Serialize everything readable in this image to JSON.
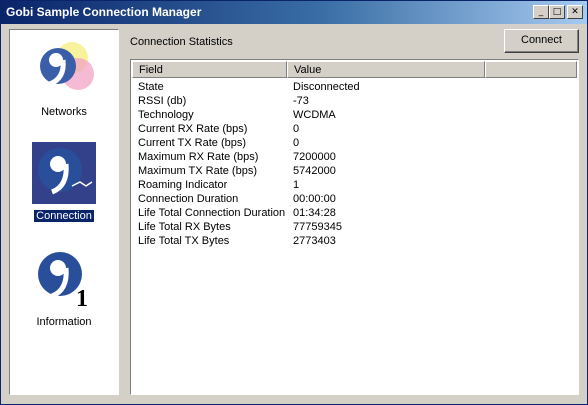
{
  "window": {
    "title": "Gobi Sample Connection Manager"
  },
  "titlebar_buttons": {
    "minimize": "_",
    "maximize": "□",
    "close": "✕"
  },
  "sidebar": {
    "items": [
      {
        "label": "Networks",
        "icon": "networks-icon",
        "selected": false
      },
      {
        "label": "Connection",
        "icon": "connection-icon",
        "selected": true
      },
      {
        "label": "Information",
        "icon": "information-icon",
        "selected": false
      }
    ]
  },
  "main": {
    "section_title": "Connection Statistics",
    "connect_label": "Connect",
    "columns": [
      "Field",
      "Value",
      ""
    ],
    "rows": [
      {
        "field": "State",
        "value": "Disconnected"
      },
      {
        "field": "RSSI (db)",
        "value": "-73"
      },
      {
        "field": "Technology",
        "value": "WCDMA"
      },
      {
        "field": "Current RX Rate (bps)",
        "value": "0"
      },
      {
        "field": "Current TX Rate (bps)",
        "value": "0"
      },
      {
        "field": "Maximum RX Rate (bps)",
        "value": "7200000"
      },
      {
        "field": "Maximum TX Rate (bps)",
        "value": "5742000"
      },
      {
        "field": "Roaming Indicator",
        "value": "1"
      },
      {
        "field": "Connection Duration",
        "value": "00:00:00"
      },
      {
        "field": "Life Total Connection Duration",
        "value": "01:34:28"
      },
      {
        "field": "Life Total RX Bytes",
        "value": "77759345"
      },
      {
        "field": "Life Total TX Bytes",
        "value": "2773403"
      }
    ]
  },
  "icon_text": {
    "information_digit": "1"
  },
  "colors": {
    "titlebar_start": "#0a246a",
    "titlebar_end": "#a6caf0",
    "selection": "#0a246a",
    "icon_blue": "#2a4f9a"
  }
}
